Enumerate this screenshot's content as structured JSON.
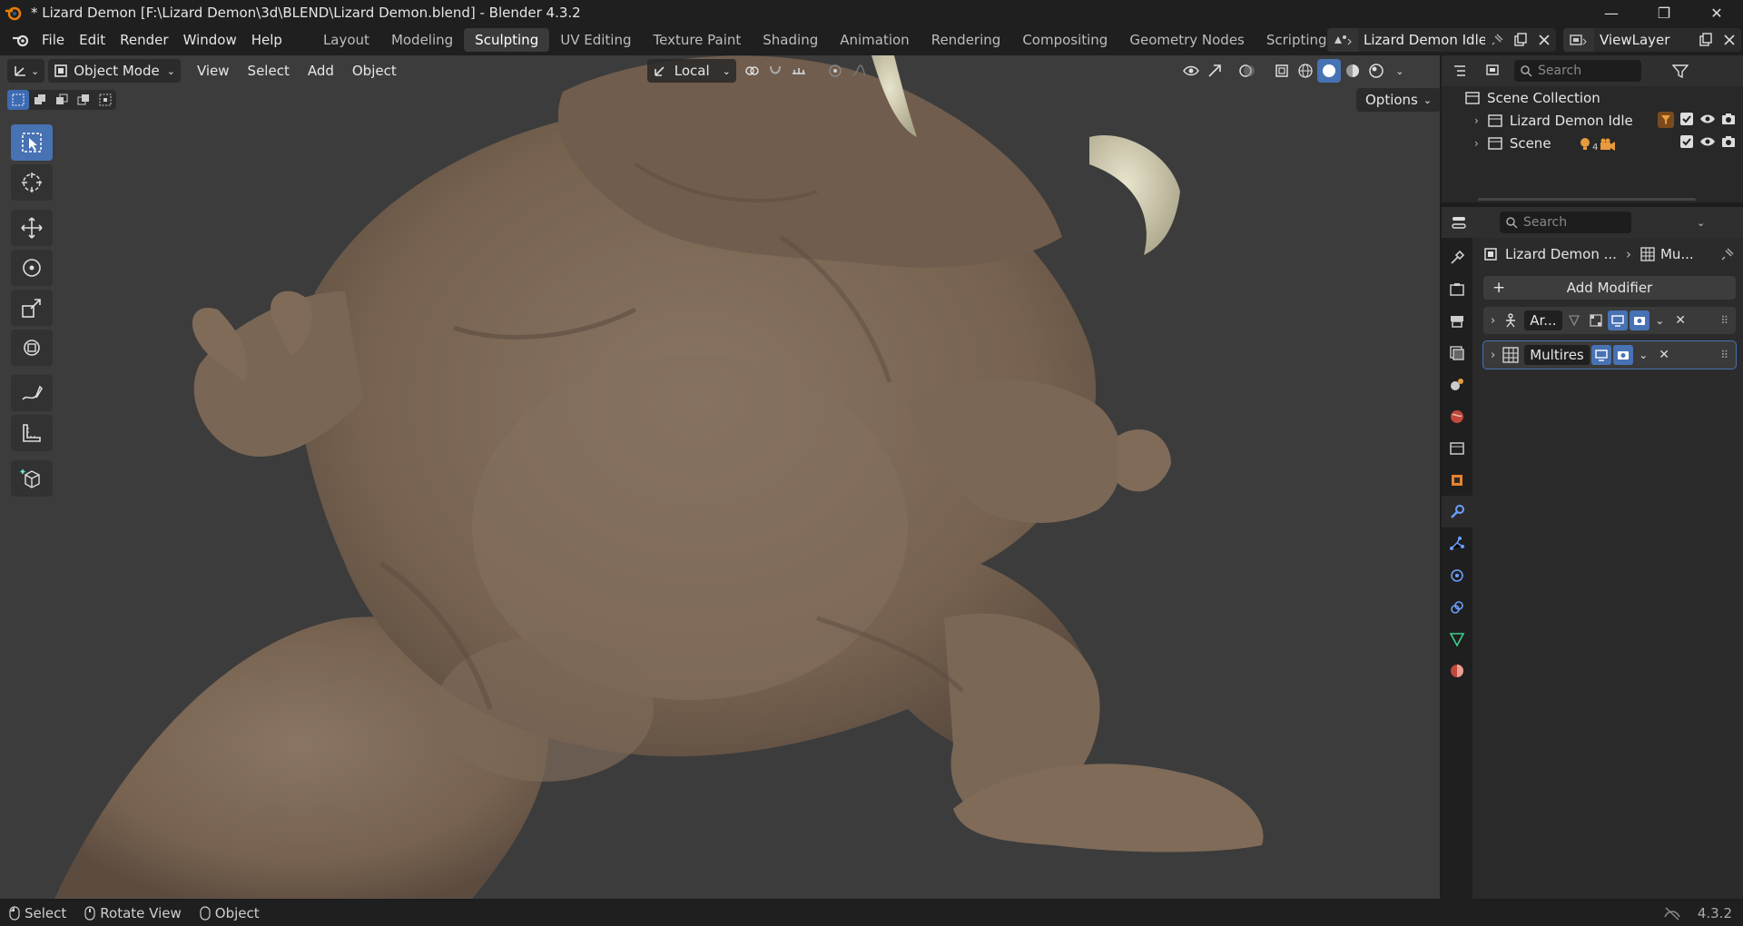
{
  "window": {
    "title": "* Lizard Demon [F:\\Lizard Demon\\3d\\BLEND\\Lizard Demon.blend] - Blender 4.3.2",
    "controls": [
      "minimize",
      "restore",
      "close"
    ]
  },
  "menu": {
    "items": [
      "File",
      "Edit",
      "Render",
      "Window",
      "Help"
    ],
    "workspaces": [
      "Layout",
      "Modeling",
      "Sculpting",
      "UV Editing",
      "Texture Paint",
      "Shading",
      "Animation",
      "Rendering",
      "Compositing",
      "Geometry Nodes",
      "Scripting"
    ],
    "active_workspace": "Sculpting",
    "scene_name": "Lizard Demon Idle",
    "view_layer": "ViewLayer"
  },
  "viewport": {
    "mode": "Object Mode",
    "menus": [
      "View",
      "Select",
      "Add",
      "Object"
    ],
    "transform_orientation": "Local",
    "options_label": "Options",
    "tools": [
      "select-box",
      "cursor",
      "move",
      "rotate",
      "scale",
      "transform",
      "annotate",
      "measure",
      "add-cube"
    ],
    "model_colors": {
      "skin": "#7d6a5a",
      "skin_shadow": "#5c4c40",
      "horn": "#cfcbb0",
      "background": "#3c3c3c"
    }
  },
  "outliner": {
    "search_placeholder": "Search",
    "root": "Scene Collection",
    "items": [
      {
        "label": "Lizard Demon Idle"
      },
      {
        "label": "Scene",
        "badge": "4"
      }
    ]
  },
  "properties": {
    "search_placeholder": "Search",
    "breadcrumb_object": "Lizard Demon ...",
    "breadcrumb_data": "Mu...",
    "add_modifier": "Add Modifier",
    "modifiers": [
      {
        "name": "Ar..."
      },
      {
        "name": "Multires"
      }
    ]
  },
  "statusbar": {
    "items": [
      "Select",
      "Rotate View",
      "Object"
    ],
    "version": "4.3.2"
  }
}
